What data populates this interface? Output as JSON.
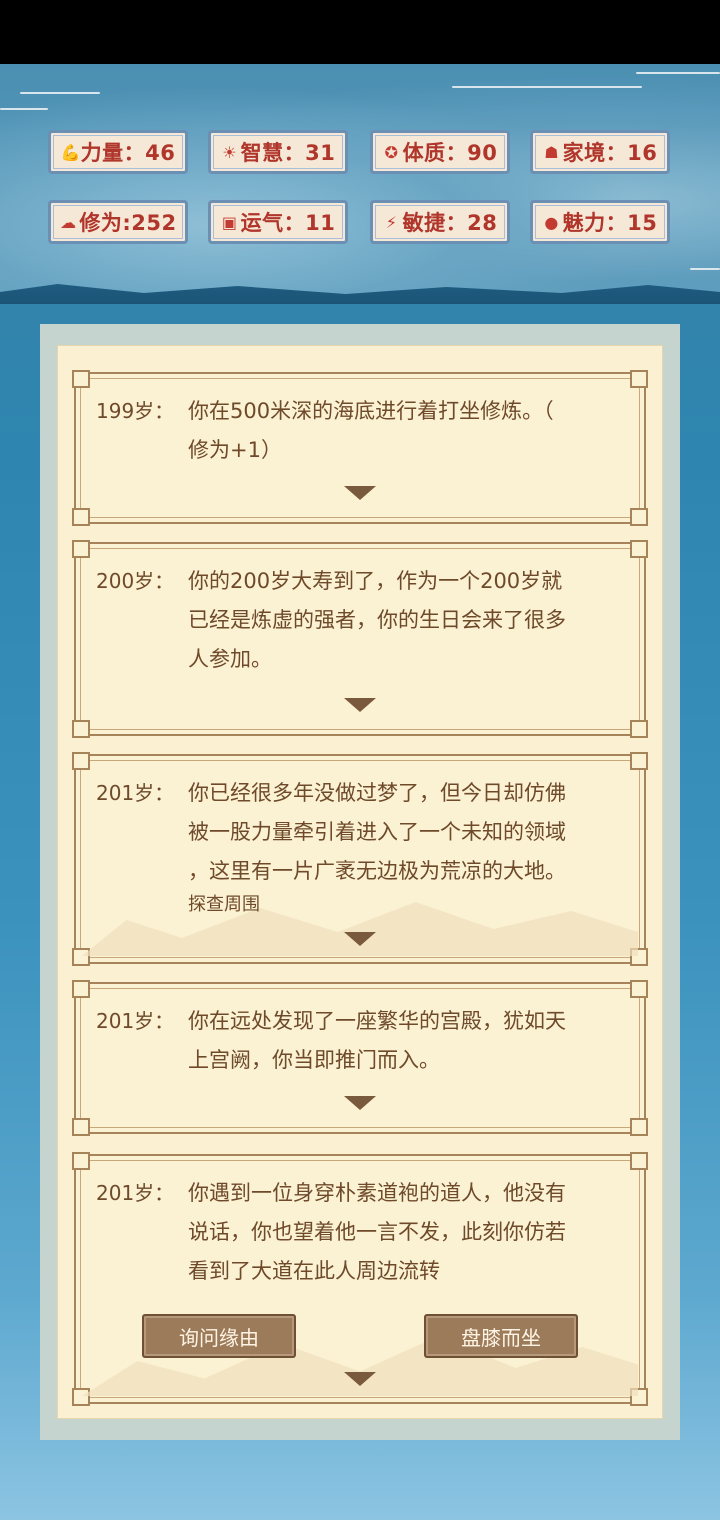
{
  "stats": [
    {
      "label": "力量：46",
      "icon": "strength-icon",
      "glyph": "💪"
    },
    {
      "label": "智慧：31",
      "icon": "wisdom-icon",
      "glyph": "☀"
    },
    {
      "label": "体质：90",
      "icon": "constitution-icon",
      "glyph": "✪"
    },
    {
      "label": "家境：16",
      "icon": "family-icon",
      "glyph": "☗"
    },
    {
      "label": "修为:252",
      "icon": "cultivation-icon",
      "glyph": "☁"
    },
    {
      "label": "运气：11",
      "icon": "luck-icon",
      "glyph": "▣"
    },
    {
      "label": "敏捷：28",
      "icon": "agility-icon",
      "glyph": "⚡"
    },
    {
      "label": "魅力：15",
      "icon": "charm-icon",
      "glyph": "●"
    }
  ],
  "log": [
    {
      "age": "199岁：",
      "lines": [
        "你在500米深的海底进行着打坐修炼。（",
        "修为+1）"
      ]
    },
    {
      "age": "200岁：",
      "lines": [
        "你的200岁大寿到了，作为一个200岁就",
        "已经是炼虚的强者，你的生日会来了很多",
        "人参加。"
      ]
    },
    {
      "age": "201岁：",
      "lines": [
        "你已经很多年没做过梦了，但今日却仿佛",
        "被一股力量牵引着进入了一个未知的领域",
        "，这里有一片广袤无边极为荒凉的大地。"
      ],
      "action": "探查周围"
    },
    {
      "age": "201岁：",
      "lines": [
        "你在远处发现了一座繁华的宫殿，犹如天",
        "上宫阙，你当即推门而入。"
      ]
    },
    {
      "age": "201岁：",
      "lines": [
        "你遇到一位身穿朴素道袍的道人，他没有",
        "说话，你也望着他一言不发，此刻你仿若",
        "看到了大道在此人周边流转"
      ]
    }
  ],
  "choices": {
    "left": "询问缘由",
    "right": "盘膝而坐"
  }
}
